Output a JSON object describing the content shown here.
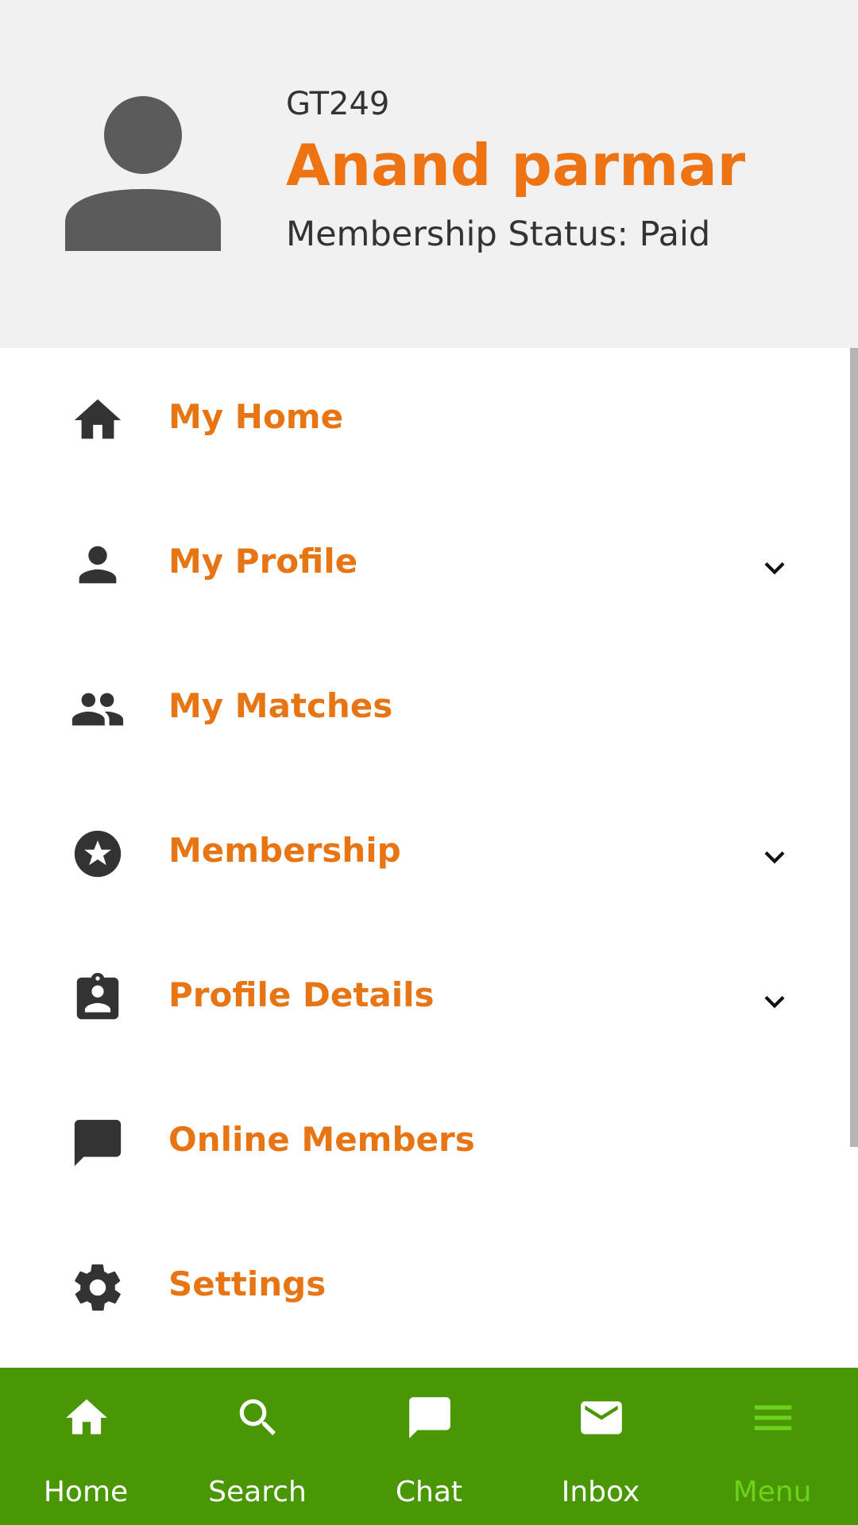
{
  "profile": {
    "id": "GT249",
    "name": "Anand parmar",
    "status": "Membership Status: Paid"
  },
  "menu": {
    "items": [
      {
        "label": "My Home",
        "icon": "home-icon",
        "expandable": false
      },
      {
        "label": "My Profile",
        "icon": "person-icon",
        "expandable": true
      },
      {
        "label": "My Matches",
        "icon": "people-icon",
        "expandable": false
      },
      {
        "label": "Membership",
        "icon": "star-circle-icon",
        "expandable": true
      },
      {
        "label": "Profile Details",
        "icon": "contact-clipboard-icon",
        "expandable": true
      },
      {
        "label": "Online Members",
        "icon": "chat-bubble-icon",
        "expandable": false
      },
      {
        "label": "Settings",
        "icon": "gear-icon",
        "expandable": false
      }
    ]
  },
  "bottom_nav": {
    "items": [
      {
        "label": "Home",
        "icon": "home-icon"
      },
      {
        "label": "Search",
        "icon": "search-icon"
      },
      {
        "label": "Chat",
        "icon": "chat-bubble-icon"
      },
      {
        "label": "Inbox",
        "icon": "mail-icon"
      },
      {
        "label": "Menu",
        "icon": "hamburger-menu-icon"
      }
    ],
    "active": "Menu"
  },
  "colors": {
    "accent": "#ee7413",
    "header_bg": "#f2f1f1",
    "nav_bg": "#4a9706",
    "nav_active": "#6dd21c",
    "icon": "#333333"
  }
}
